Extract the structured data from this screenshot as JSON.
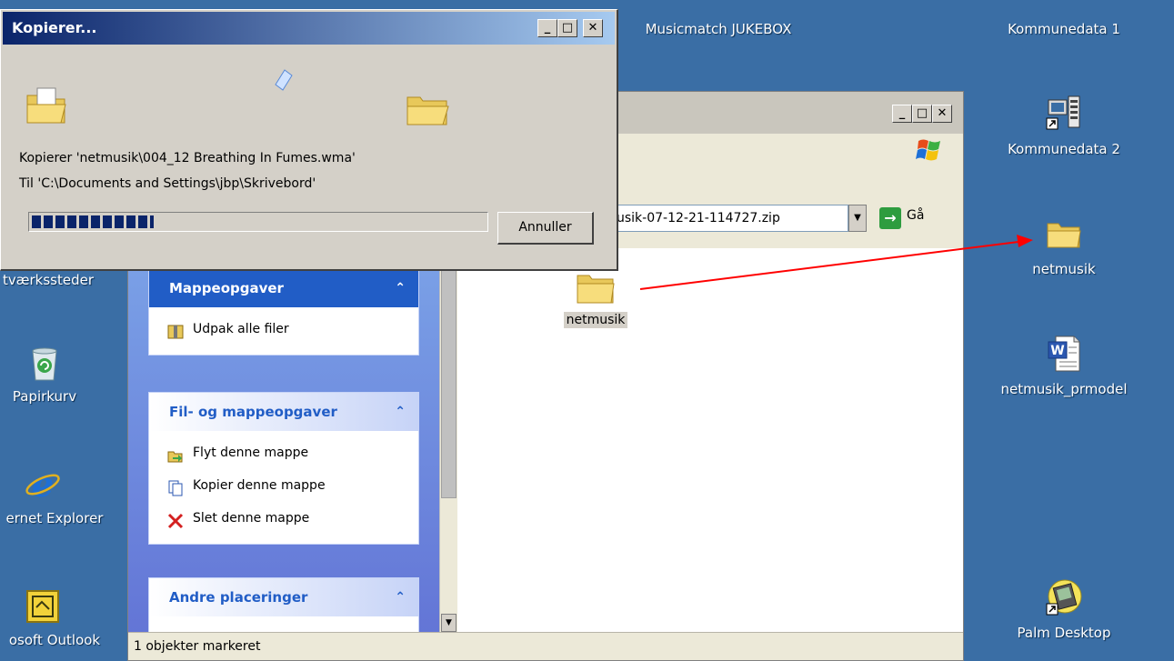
{
  "desktop": {
    "icons_right": [
      {
        "label": "Kommunedata 1"
      },
      {
        "label": "Kommunedata 2"
      },
      {
        "label": "netmusik"
      },
      {
        "label": "netmusik_prmodel"
      },
      {
        "label": "Palm Desktop"
      }
    ],
    "icon_top": {
      "label": "Musicmatch JUKEBOX"
    },
    "icons_left": [
      {
        "label": "tværkssteder"
      },
      {
        "label": "Papirkurv"
      },
      {
        "label": "ernet Explorer"
      },
      {
        "label": "osoft Outlook"
      }
    ]
  },
  "copy_dialog": {
    "title": "Kopierer...",
    "line1": "Kopierer 'netmusik\\004_12 Breathing In Fumes.wma'",
    "line2": "Til 'C:\\Documents and Settings\\jbp\\Skrivebord'",
    "progress_fraction": 0.27,
    "cancel_label": "Annuller"
  },
  "explorer": {
    "address": "usik-07-12-21-114727.zip",
    "go_label": "Gå",
    "sections": [
      {
        "title": "Mappeopgaver",
        "items": [
          "Udpak alle filer"
        ]
      },
      {
        "title": "Fil- og mappeopgaver",
        "items": [
          "Flyt denne mappe",
          "Kopier denne mappe",
          "Slet denne mappe"
        ]
      },
      {
        "title": "Andre placeringer",
        "items": []
      }
    ],
    "folder_label": "netmusik",
    "status_text": "1 objekter markeret"
  },
  "colors": {
    "desktop_bg": "#3a6ea5",
    "title_gradient_start": "#0a246a",
    "progress_fill": "#0a246a",
    "arrow": "#ff0000"
  }
}
